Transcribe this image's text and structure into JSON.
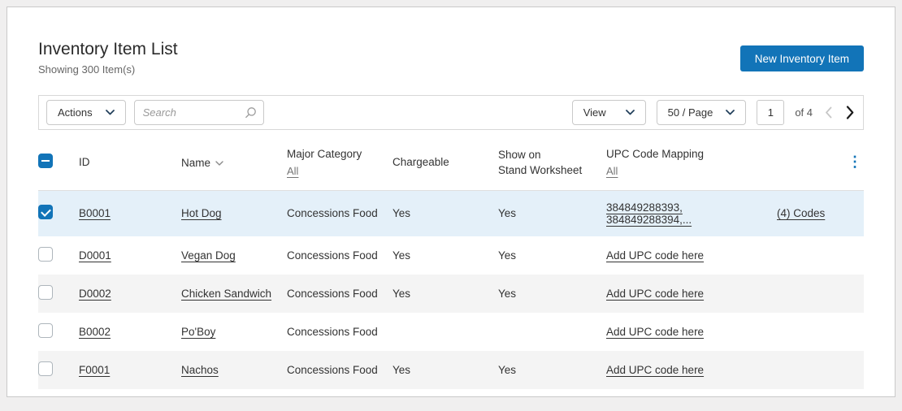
{
  "header": {
    "title": "Inventory Item List",
    "subtitle": "Showing 300 Item(s)",
    "new_button_label": "New Inventory Item"
  },
  "toolbar": {
    "actions_label": "Actions",
    "search_placeholder": "Search",
    "view_label": "View",
    "per_page_label": "50 / Page",
    "page_number": "1",
    "page_total": "of 4"
  },
  "table": {
    "columns": {
      "id": "ID",
      "name": "Name",
      "major_category": "Major Category",
      "major_category_filter": "All",
      "chargeable": "Chargeable",
      "show_on_stand_line1": "Show on",
      "show_on_stand_line2": "Stand Worksheet",
      "upc": "UPC Code Mapping",
      "upc_filter": "All"
    },
    "rows": [
      {
        "id": "B0001",
        "name": "Hot Dog",
        "category": "Concessions Food",
        "chargeable": "Yes",
        "show_on_stand": "Yes",
        "upc": "384849288393, 384849288394,...",
        "codes": "(4) Codes"
      },
      {
        "id": "D0001",
        "name": "Vegan Dog",
        "category": "Concessions Food",
        "chargeable": "Yes",
        "show_on_stand": "Yes",
        "upc": "Add UPC code here",
        "codes": ""
      },
      {
        "id": "D0002",
        "name": "Chicken Sandwich",
        "category": "Concessions Food",
        "chargeable": "Yes",
        "show_on_stand": "Yes",
        "upc": "Add UPC code here",
        "codes": ""
      },
      {
        "id": "B0002",
        "name": "Po'Boy",
        "category": "Concessions Food",
        "chargeable": "",
        "show_on_stand": "",
        "upc": "Add UPC code here",
        "codes": ""
      },
      {
        "id": "F0001",
        "name": "Nachos",
        "category": "Concessions Food",
        "chargeable": "Yes",
        "show_on_stand": "Yes",
        "upc": "Add UPC code here",
        "codes": ""
      }
    ]
  },
  "colors": {
    "primary": "#1274b8",
    "selected_row": "#e4f0f9"
  }
}
